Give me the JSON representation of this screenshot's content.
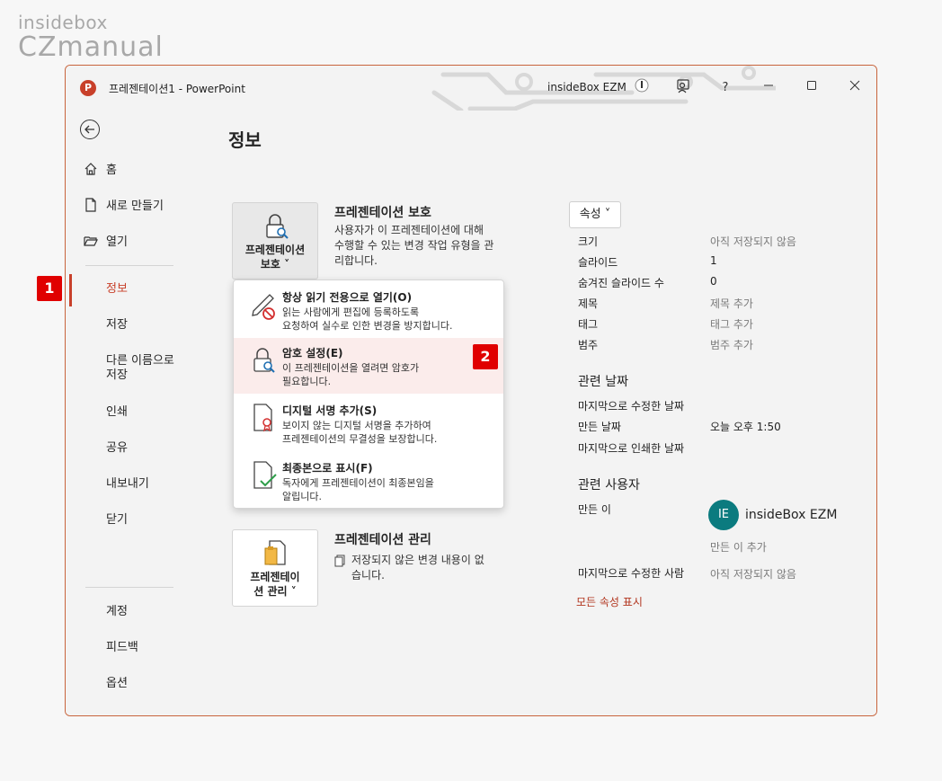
{
  "watermark": {
    "line1": "insidebox",
    "line2": "CZmanual"
  },
  "window": {
    "title": "프레젠테이션1  -  PowerPoint",
    "app_icon": "P",
    "user": "insideBox EZM",
    "help": "?",
    "buttons": [
      "minimize-icon",
      "restore-icon",
      "close-icon"
    ]
  },
  "sidebar": {
    "items": [
      {
        "label": "홈",
        "icon": "home-icon"
      },
      {
        "label": "새로 만들기",
        "icon": "new-document-icon"
      },
      {
        "label": "열기",
        "icon": "folder-open-icon"
      },
      {
        "label": "정보",
        "active": true
      },
      {
        "label": "저장"
      },
      {
        "label": "다른 이름으로\n저장"
      },
      {
        "label": "인쇄"
      },
      {
        "label": "공유"
      },
      {
        "label": "내보내기"
      },
      {
        "label": "닫기"
      },
      {
        "label": "계정"
      },
      {
        "label": "피드백"
      },
      {
        "label": "옵션"
      }
    ]
  },
  "main": {
    "title": "정보",
    "protect": {
      "button_label_1": "프레젠테이션",
      "button_label_2": "보호 ˅",
      "title": "프레젠테이션 보호",
      "desc_1": "사용자가 이 프레젠테이션에 대해",
      "desc_2": "수행할 수 있는 변경 작업 유형을 관",
      "desc_3": "리합니다."
    },
    "dropdown": [
      {
        "title": "항상 읽기 전용으로 열기(O)",
        "desc_1": "읽는 사람에게 편집에 등록하도록",
        "desc_2": "요청하여 실수로 인한 변경을 방지합니다.",
        "icon": "read-only-pencil-icon"
      },
      {
        "title": "암호 설정(E)",
        "desc_1": "이 프레젠테이션을 열려면 암호가",
        "desc_2": "필요합니다.",
        "icon": "lock-key-icon",
        "highlighted": true
      },
      {
        "title": "디지털 서명 추가(S)",
        "desc_1": "보이지 않는 디지털 서명을 추가하여",
        "desc_2": "프레젠테이션의 무결성을 보장합니다.",
        "icon": "signature-ribbon-icon"
      },
      {
        "title": "최종본으로 표시(F)",
        "desc_1": "독자에게 프레젠테이션이 최종본임을",
        "desc_2": "알립니다.",
        "icon": "final-check-icon"
      }
    ],
    "manage": {
      "button_label_1": "프레젠테이",
      "button_label_2": "션 관리 ˅",
      "title": "프레젠테이션 관리",
      "desc_1": "저장되지 않은 변경 내용이 없",
      "desc_2": "습니다."
    }
  },
  "properties": {
    "button": "속성 ˅",
    "rows": [
      {
        "label": "크기",
        "value": "아직 저장되지 않음",
        "muted": true
      },
      {
        "label": "슬라이드",
        "value": "1"
      },
      {
        "label": "숨겨진 슬라이드 수",
        "value": "0"
      },
      {
        "label": "제목",
        "value": "제목 추가",
        "muted": true
      },
      {
        "label": "태그",
        "value": "태그 추가",
        "muted": true
      },
      {
        "label": "범주",
        "value": "범주 추가",
        "muted": true
      }
    ],
    "dates_heading": "관련 날짜",
    "dates": [
      {
        "label": "마지막으로 수정한 날짜",
        "value": ""
      },
      {
        "label": "만든 날짜",
        "value": "오늘 오후 1:50"
      },
      {
        "label": "마지막으로 인쇄한 날짜",
        "value": ""
      }
    ],
    "people_heading": "관련 사용자",
    "author_label": "만든 이",
    "author_initials": "IE",
    "author_name": "insideBox EZM",
    "add_author": "만든 이 추가",
    "last_modified_by_label": "마지막으로 수정한 사람",
    "last_modified_by_value": "아직 저장되지 않음",
    "show_all": "모든 속성 표시"
  },
  "badges": {
    "step1": "1",
    "step2": "2"
  },
  "colors": {
    "accent": "#c8402a",
    "badge": "#e00000",
    "avatar": "#0b7b7f"
  }
}
